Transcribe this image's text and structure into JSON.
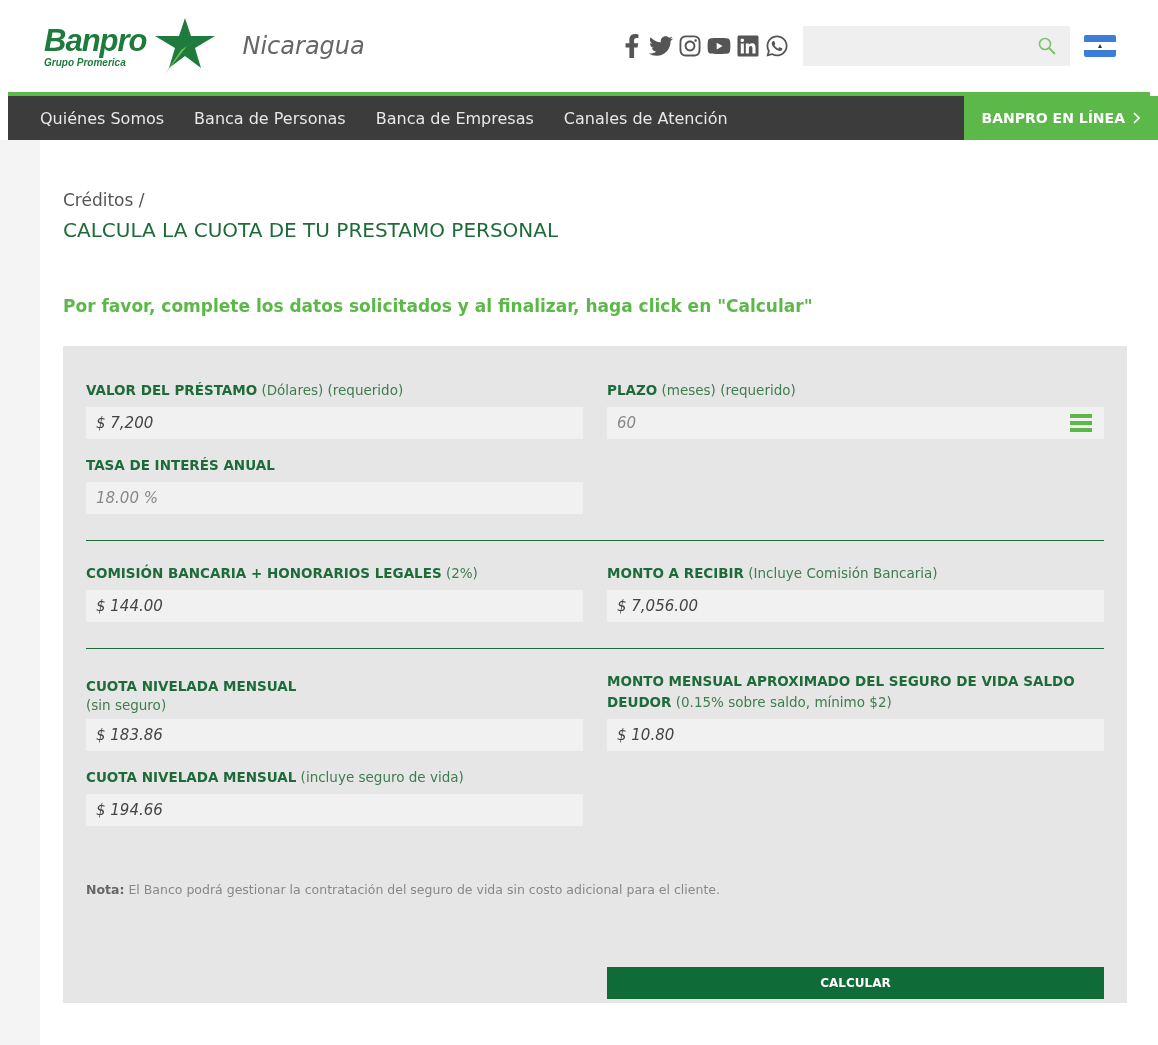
{
  "header": {
    "logo": {
      "name": "Banpro",
      "tagline": "Grupo Promerica"
    },
    "country": "Nicaragua"
  },
  "nav": {
    "items": [
      "Quiénes Somos",
      "Banca de Personas",
      "Banca de Empresas",
      "Canales de Atención"
    ],
    "cta": "BANPRO EN LÍNEA"
  },
  "breadcrumb": "Créditos /",
  "title": "CALCULA LA CUOTA DE TU PRESTAMO PERSONAL",
  "instructions": "Por favor, complete los datos solicitados y al finalizar, haga click en \"Calcular\"",
  "form": {
    "groups": [
      {
        "fields": [
          {
            "kind": "input",
            "label": "**VALOR DEL PRÉSTAMO** (Dólares) (requerido)",
            "value": "$ 7,200"
          },
          {
            "kind": "select",
            "label": "**PLAZO** (meses) (requerido)",
            "placeholder": "60"
          },
          {
            "kind": "input",
            "label": "**TASA DE INTERÉS ANUAL**",
            "placeholder": "18.00 %"
          }
        ]
      },
      {
        "fields": [
          {
            "kind": "input",
            "label": "**COMISIÓN BANCARIA + HONORARIOS LEGALES** (2%)",
            "value": "$ 144.00"
          },
          {
            "kind": "input",
            "label": "**MONTO A RECIBIR** (Incluye Comisión Bancaria)",
            "value": "$ 7,056.00"
          }
        ]
      },
      {
        "fields": [
          {
            "kind": "input",
            "label": "**CUOTA NIVELADA MENSUAL**",
            "sublabel": "(sin seguro)",
            "value": "$ 183.86"
          },
          {
            "kind": "input",
            "label": "**MONTO MENSUAL APROXIMADO DEL SEGURO DE VIDA SALDO DEUDOR** (0.15% sobre saldo, mínimo $2)",
            "value": "$ 10.80"
          },
          {
            "kind": "input",
            "label": "**CUOTA NIVELADA MENSUAL** (incluye seguro de vida)",
            "value": "$ 194.66"
          }
        ]
      }
    ],
    "note": "**Nota:** El Banco podrá gestionar la contratación del seguro de vida sin costo adicional para el cliente.",
    "submit": "CALCULAR"
  }
}
